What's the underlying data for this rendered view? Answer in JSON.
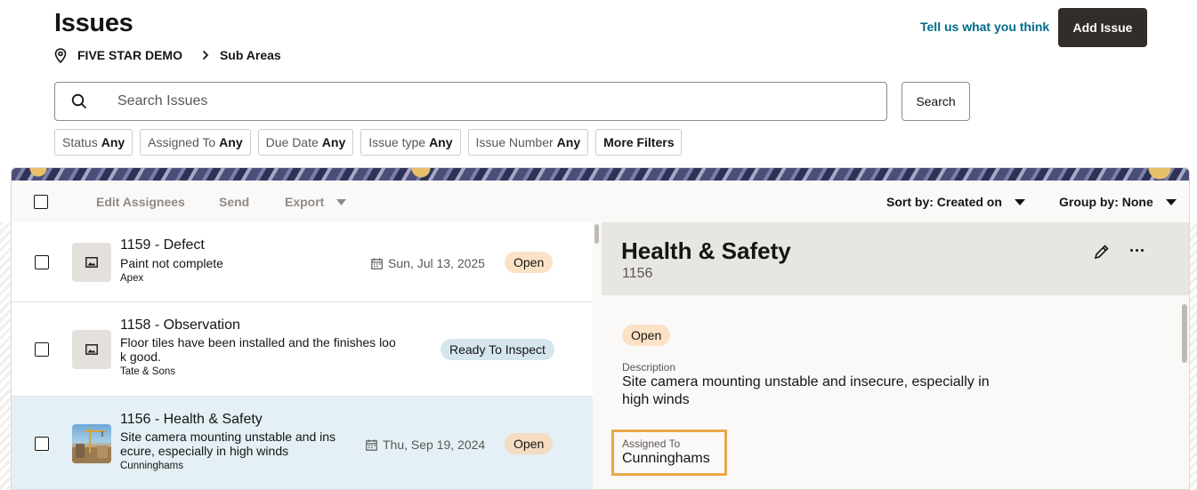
{
  "header": {
    "title": "Issues",
    "breadcrumb": [
      "FIVE STAR DEMO",
      "Sub Areas"
    ],
    "feedback_link": "Tell us what you think",
    "add_button": "Add Issue"
  },
  "search": {
    "placeholder": "Search Issues",
    "value": "",
    "button": "Search"
  },
  "filters": [
    {
      "label": "Status",
      "value": "Any"
    },
    {
      "label": "Assigned To",
      "value": "Any"
    },
    {
      "label": "Due Date",
      "value": "Any"
    },
    {
      "label": "Issue type",
      "value": "Any"
    },
    {
      "label": "Issue Number",
      "value": "Any"
    }
  ],
  "more_filters": "More Filters",
  "toolbar": {
    "edit_assignees": "Edit Assignees",
    "send": "Send",
    "export": "Export",
    "sort_by": "Sort by: Created on",
    "group_by": "Group by: None"
  },
  "issues": [
    {
      "title": "1159 - Defect",
      "description": "Paint not complete",
      "organization": "Apex",
      "date": "Sun, Jul 13, 2025",
      "status": "Open"
    },
    {
      "title": "1158 - Observation",
      "description_lines": [
        "Floor tiles have been installed and the finishes loo",
        "k good."
      ],
      "organization": "Tate & Sons",
      "date": "",
      "status": "Ready To Inspect"
    },
    {
      "title": "1156 - Health & Safety",
      "description_lines": [
        "Site camera mounting unstable and ins",
        "ecure, especially in high winds"
      ],
      "organization": "Cunninghams",
      "date": "Thu, Sep 19, 2024",
      "status": "Open"
    }
  ],
  "detail": {
    "title": "Health & Safety",
    "number": "1156",
    "status": "Open",
    "description_label": "Description",
    "description_lines": [
      "Site camera mounting unstable and insecure, especially in",
      "high winds"
    ],
    "assigned_label": "Assigned To",
    "assigned_value": "Cunninghams"
  },
  "colors": {
    "primary_button": "#312d2a",
    "link": "#00698a",
    "badge_open": "#fbe2c6",
    "badge_inspect": "#d5e6ef",
    "selected_row": "#e4f0f5",
    "highlight_border": "#e8a94a"
  },
  "icons": {
    "location": "location-pin-icon",
    "breadcrumb_separator": "chevron-right-icon",
    "search": "search-icon",
    "image_placeholder": "image-icon",
    "calendar": "calendar-icon",
    "edit": "pencil-icon",
    "more": "more-horizontal-icon",
    "dropdown": "caret-down-icon"
  }
}
